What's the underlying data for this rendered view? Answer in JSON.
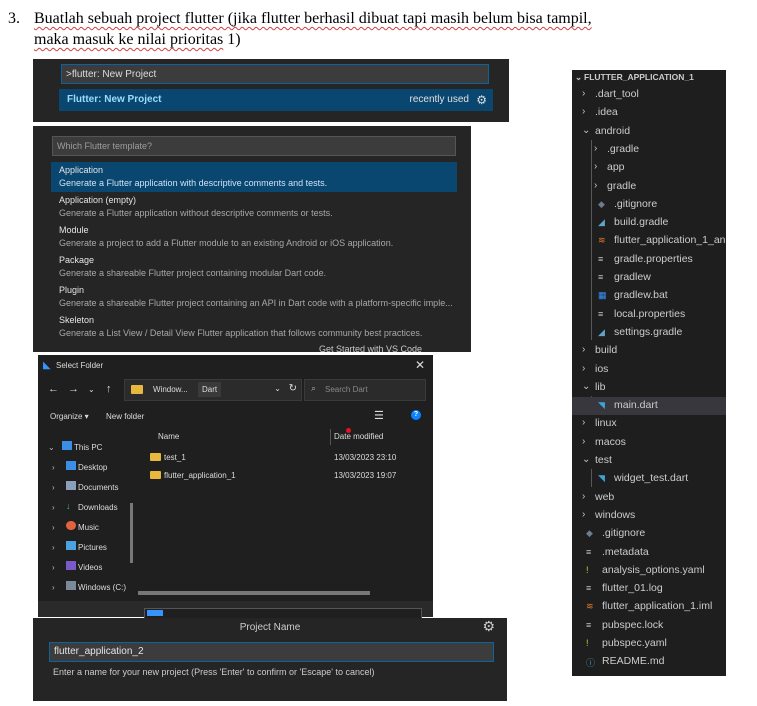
{
  "doc": {
    "number": "3.",
    "text_line1": "Buatlah sebuah project flutter (jika flutter berhasil dibuat tapi masih belum bisa tampil,",
    "text_line2_a": "maka masuk ke nilai prioritas",
    "text_line2_b": " 1)"
  },
  "command_palette": {
    "input_value": ">flutter: New Project",
    "item_label": "Flutter: New Project",
    "item_meta": "recently used",
    "gear_icon": "gear-icon"
  },
  "template_picker": {
    "placeholder": "Which Flutter template?",
    "items": [
      {
        "title": "Application",
        "desc": "Generate a Flutter application with descriptive comments and tests."
      },
      {
        "title": "Application (empty)",
        "desc": "Generate a Flutter application without descriptive comments or tests."
      },
      {
        "title": "Module",
        "desc": "Generate a project to add a Flutter module to an existing Android or iOS application."
      },
      {
        "title": "Package",
        "desc": "Generate a shareable Flutter project containing modular Dart code."
      },
      {
        "title": "Plugin",
        "desc": "Generate a shareable Flutter project containing an API in Dart code with a platform-specific imple..."
      },
      {
        "title": "Skeleton",
        "desc": "Generate a List View / Detail View Flutter application that follows community best practices."
      }
    ],
    "underlay_text": "Get Started with VS Code",
    "edge_letter": "C"
  },
  "file_dialog": {
    "title": "Select Folder",
    "address": {
      "seg1": "Window...",
      "seg2": "Dart"
    },
    "search_placeholder": "Search Dart",
    "organize": "Organize ▾",
    "new_folder": "New folder",
    "sidebar": [
      "This PC",
      "Desktop",
      "Documents",
      "Downloads",
      "Music",
      "Pictures",
      "Videos",
      "Windows (C:)"
    ],
    "columns": {
      "name": "Name",
      "date": "Date modified"
    },
    "files": [
      {
        "name": "test_1",
        "date": "13/03/2023 23:10"
      },
      {
        "name": "flutter_application_1",
        "date": "13/03/2023 19:07"
      }
    ],
    "colors": {
      "folder": "#e8b83e",
      "accent": "#3794ff"
    }
  },
  "project_name": {
    "title": "Project Name",
    "input_value": "flutter_application_2",
    "hint": "Enter a name for your new project (Press 'Enter' to confirm or 'Escape' to cancel)"
  },
  "explorer": {
    "root": "FLUTTER_APPLICATION_1",
    "items": [
      {
        "label": ".dart_tool",
        "chevron": "›"
      },
      {
        "label": ".idea",
        "chevron": "›"
      },
      {
        "label": "android",
        "chevron": "⌄"
      },
      {
        "label": ".gradle",
        "chevron": "›"
      },
      {
        "label": "app",
        "chevron": "›"
      },
      {
        "label": "gradle",
        "chevron": "›"
      },
      {
        "label": ".gitignore",
        "icon": "git-icon"
      },
      {
        "label": "build.gradle",
        "icon": "gradle-icon"
      },
      {
        "label": "flutter_application_1_an...",
        "icon": "rss-icon"
      },
      {
        "label": "gradle.properties",
        "icon": "lines-icon"
      },
      {
        "label": "gradlew",
        "icon": "lines-icon"
      },
      {
        "label": "gradlew.bat",
        "icon": "windows-icon"
      },
      {
        "label": "local.properties",
        "icon": "lines-icon"
      },
      {
        "label": "settings.gradle",
        "icon": "gradle-icon"
      },
      {
        "label": "build",
        "chevron": "›"
      },
      {
        "label": "ios",
        "chevron": "›"
      },
      {
        "label": "lib",
        "chevron": "⌄"
      },
      {
        "label": "main.dart",
        "icon": "dart-icon"
      },
      {
        "label": "linux",
        "chevron": "›"
      },
      {
        "label": "macos",
        "chevron": "›"
      },
      {
        "label": "test",
        "chevron": "⌄"
      },
      {
        "label": "widget_test.dart",
        "icon": "dart-icon"
      },
      {
        "label": "web",
        "chevron": "›"
      },
      {
        "label": "windows",
        "chevron": "›"
      },
      {
        "label": ".gitignore",
        "icon": "git-icon"
      },
      {
        "label": ".metadata",
        "icon": "lines-icon"
      },
      {
        "label": "analysis_options.yaml",
        "icon": "exclamation-icon"
      },
      {
        "label": "flutter_01.log",
        "icon": "lines-icon"
      },
      {
        "label": "flutter_application_1.iml",
        "icon": "rss-icon"
      },
      {
        "label": "pubspec.lock",
        "icon": "lines-icon"
      },
      {
        "label": "pubspec.yaml",
        "icon": "exclamation-icon"
      },
      {
        "label": "README.md",
        "icon": "info-icon"
      }
    ]
  }
}
